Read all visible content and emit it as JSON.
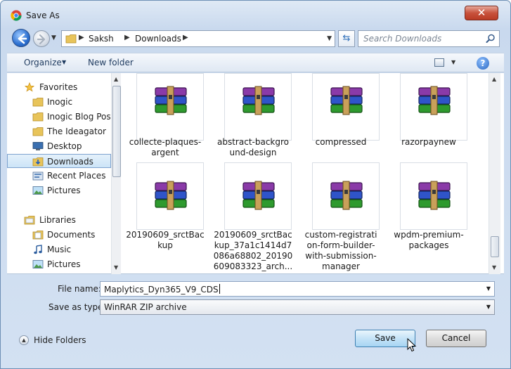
{
  "window": {
    "title": "Save As",
    "close_glyph": "✕",
    "app_icon": "chrome-icon"
  },
  "navbar": {
    "breadcrumbs": [
      "Saksh",
      "Downloads"
    ],
    "search_placeholder": "Search Downloads",
    "refresh_glyph": "⇆"
  },
  "toolbar": {
    "organize_label": "Organize",
    "new_folder_label": "New folder",
    "help_glyph": "?"
  },
  "nav_pane": {
    "favorites_label": "Favorites",
    "favorites": [
      {
        "label": "Inogic",
        "icon": "folder-icon"
      },
      {
        "label": "Inogic Blog Posts",
        "icon": "folder-icon"
      },
      {
        "label": "The Ideagator",
        "icon": "folder-icon"
      },
      {
        "label": "Desktop",
        "icon": "desktop-icon"
      },
      {
        "label": "Downloads",
        "icon": "downloads-folder-icon",
        "selected": true
      },
      {
        "label": "Recent Places",
        "icon": "recent-places-icon"
      },
      {
        "label": "Pictures",
        "icon": "pictures-icon"
      }
    ],
    "libraries_label": "Libraries",
    "libraries": [
      {
        "label": "Documents",
        "icon": "documents-icon"
      },
      {
        "label": "Music",
        "icon": "music-icon"
      },
      {
        "label": "Pictures",
        "icon": "pictures-icon"
      }
    ]
  },
  "files": [
    {
      "name": "collecte-plaques-argent",
      "lines": [
        "collecte-plaques-",
        "argent"
      ]
    },
    {
      "name": "abstract-background-design",
      "lines": [
        "abstract-backgro",
        "und-design"
      ]
    },
    {
      "name": "compressed",
      "lines": [
        "compressed"
      ]
    },
    {
      "name": "razorpaynew",
      "lines": [
        "razorpaynew"
      ]
    },
    {
      "name": "20190609_srctBackup",
      "lines": [
        "20190609_srctBac",
        "kup"
      ]
    },
    {
      "name": "20190609_srctBackup_37a1c1414d7086a68802_20190609083323_arch...",
      "lines": [
        "20190609_srctBac",
        "kup_37a1c1414d7",
        "086a68802_20190",
        "609083323_arch..."
      ]
    },
    {
      "name": "custom-registration-form-builder-with-submission-manager",
      "lines": [
        "custom-registrati",
        "on-form-builder-",
        "with-submission-",
        "manager"
      ]
    },
    {
      "name": "wpdm-premium-packages",
      "lines": [
        "wpdm-premium-",
        "packages"
      ]
    }
  ],
  "form": {
    "file_name_label": "File name:",
    "file_name_value": "Maplytics_Dyn365_V9_CDS",
    "save_type_label": "Save as type:",
    "save_type_value": "WinRAR ZIP archive"
  },
  "footer": {
    "hide_folders_label": "Hide Folders",
    "save_label": "Save",
    "cancel_label": "Cancel"
  },
  "colors": {
    "accent": "#2b6fd0",
    "selection": "#cce4f7",
    "close_button": "#c8523d"
  }
}
